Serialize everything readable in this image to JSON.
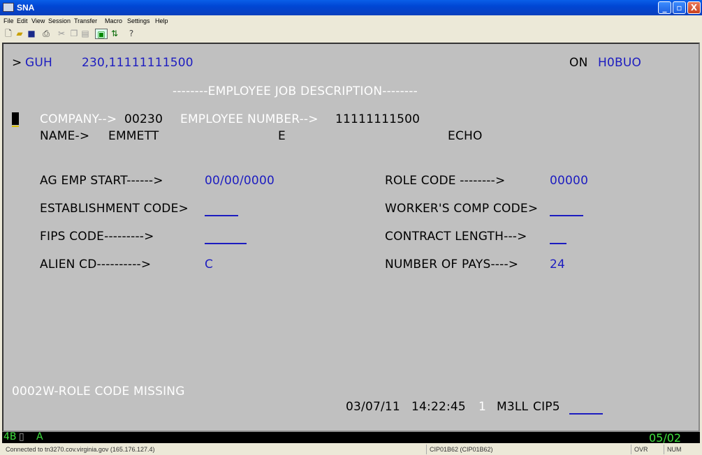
{
  "window": {
    "title": "SNA",
    "minimize": "_",
    "maximize": "▫",
    "close": "X"
  },
  "menu": [
    "File",
    "Edit",
    "View",
    "Session",
    "Transfer",
    "Macro",
    "Settings",
    "Help"
  ],
  "toolbar_icons": [
    "new-icon",
    "open-icon",
    "save-icon",
    "print-icon",
    "cut-icon",
    "copy-icon",
    "paste-icon",
    "send-icon",
    "transfer-icon",
    "help-icon"
  ],
  "terminal": {
    "prompt": ">",
    "command": "GUH",
    "command_args": "230,11111111500",
    "on_label": "ON",
    "system_id": "H0BUO",
    "screen_title": "--------EMPLOYEE JOB DESCRIPTION--------",
    "company_label": "COMPANY-->",
    "company_value": "00230",
    "emp_num_label": "EMPLOYEE NUMBER-->",
    "emp_num_value": "11111111500",
    "name_label": "NAME->",
    "first_name": "EMMETT",
    "middle_initial": "E",
    "last_name": "ECHO",
    "fields_left": [
      {
        "label": "AG EMP START------>",
        "value": "00/00/0000"
      },
      {
        "label": "ESTABLISHMENT CODE>",
        "value": ""
      },
      {
        "label": "FIPS CODE--------->",
        "value": ""
      },
      {
        "label": "ALIEN CD---------->",
        "value": "C"
      }
    ],
    "fields_right": [
      {
        "label": "ROLE CODE -------->",
        "value": "00000"
      },
      {
        "label": "WORKER'S COMP CODE>",
        "value": ""
      },
      {
        "label": "CONTRACT LENGTH--->",
        "value": ""
      },
      {
        "label": "NUMBER OF PAYS---->",
        "value": "24"
      }
    ],
    "message": "0002W-ROLE CODE MISSING",
    "date": "03/07/11",
    "time": "14:22:45",
    "separator": "1",
    "terminal_id": "M3LL",
    "cics_label": "CIP5"
  },
  "oia": {
    "left": "4B",
    "mode": "A",
    "cursor_pos": "05/02"
  },
  "statusbar": {
    "connection": "Connected to tn3270.cov.virginia.gov (165.176.127.4)",
    "lu_name": "CIP01B62 (CIP01B62)",
    "ovr": "OVR",
    "num": "NUM"
  }
}
